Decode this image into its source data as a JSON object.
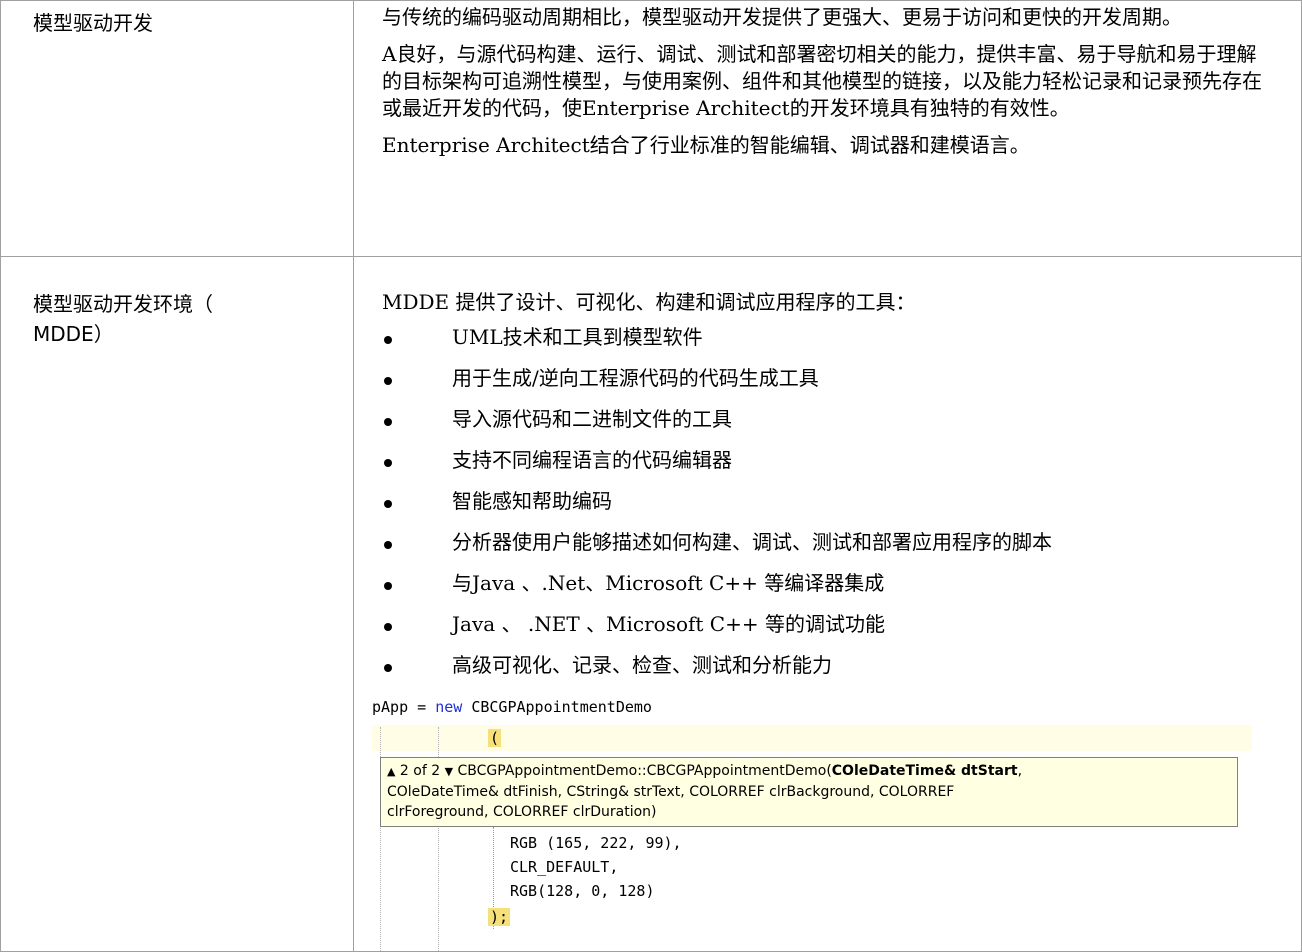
{
  "rows": [
    {
      "term": "模型驱动开发",
      "paragraphs": [
        "与传统的编码驱动周期相比，模型驱动开发提供了更强大、更易于访问和更快的开发周期。",
        "A良好，与源代码构建、运行、调试、测试和部署密切相关的能力，提供丰富、易于导航和易于理解的目标架构可追溯性模型，与使用案例、组件和其他模型的链接，以及能力轻松记录和记录预先存在或最近开发的代码，使Enterprise Architect的开发环境具有独特的有效性。",
        "Enterprise Architect结合了行业标准的智能编辑、调试器和建模语言。"
      ]
    },
    {
      "term_line1": "模型驱动开发环境（",
      "term_line2": "MDDE）",
      "intro": "MDDE 提供了设计、可视化、构建和调试应用程序的工具：",
      "bullets": [
        "UML技术和工具到模型软件",
        "用于生成/逆向工程源代码的代码生成工具",
        "导入源代码和二进制文件的工具",
        "支持不同编程语言的代码编辑器",
        "智能感知帮助编码",
        "分析器使用户能够描述如何构建、调试、测试和部署应用程序的脚本",
        "与Java 、.Net、Microsoft C++ 等编译器集成",
        "Java 、 .NET 、Microsoft C++ 等的调试功能",
        "高级可视化、记录、检查、测试和分析能力"
      ]
    }
  ],
  "code": {
    "line1_var": "pApp = ",
    "line1_kw": "new",
    "line1_rest": " CBCGPAppointmentDemo",
    "line2": "(",
    "tooltip_counter": "2 of 2",
    "tooltip_sig": "CBCGPAppointmentDemo::CBCGPAppointmentDemo(",
    "tooltip_bold_param": "COleDateTime& dtStart",
    "tooltip_rest1": ",",
    "tooltip_line2": "COleDateTime& dtFinish, CString& strText, COLORREF clrBackground, COLORREF",
    "tooltip_line3": "clrForeground, COLORREF clrDuration)",
    "line_rgb1": "RGB (165, 222, 99),",
    "line_clr": "CLR_DEFAULT,",
    "line_rgb2": "RGB(128, 0, 128)",
    "line_end": ");"
  }
}
